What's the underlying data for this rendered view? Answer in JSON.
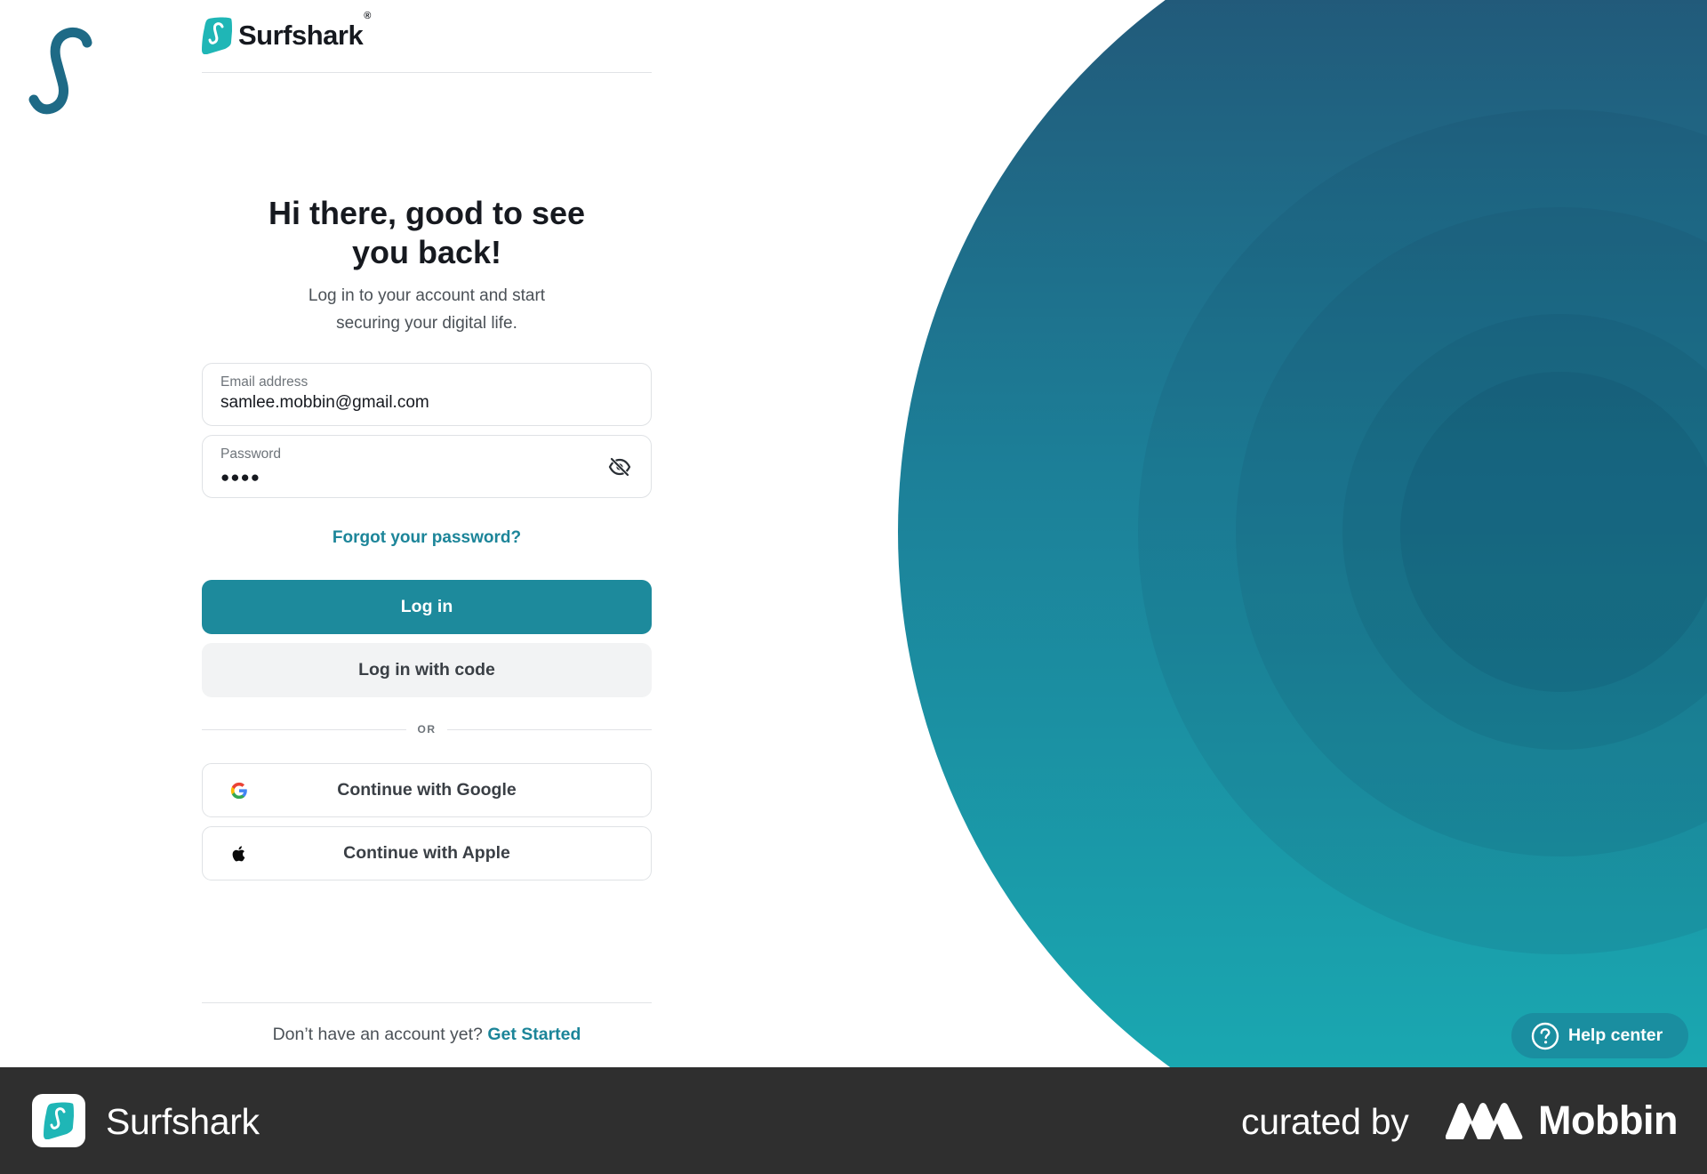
{
  "brand": {
    "name": "Surfshark",
    "registered_mark": "®"
  },
  "login": {
    "headline_line1": "Hi there, good to see",
    "headline_line2": "you back!",
    "subtitle_line1": "Log in to your account and start",
    "subtitle_line2": "securing your digital life.",
    "email": {
      "label": "Email address",
      "value": "samlee.mobbin@gmail.com"
    },
    "password": {
      "label": "Password",
      "value": "●●●●",
      "toggle_icon": "eye-slash-icon"
    },
    "forgot_password": "Forgot your password?",
    "login_button": "Log in",
    "login_with_code_button": "Log in with code",
    "divider_text": "OR",
    "google_button": "Continue with Google",
    "apple_button": "Continue with Apple",
    "signup_prompt": "Don’t have an account yet?",
    "signup_link": "Get Started"
  },
  "help": {
    "label": "Help center",
    "icon": "question-circle-icon"
  },
  "footer": {
    "app_name": "Surfshark",
    "curated_by": "curated by",
    "curator": "Mobbin"
  },
  "colors": {
    "accent": "#1d8a9c",
    "link": "#1c8599",
    "hero_top": "#245072",
    "hero_bottom": "#1ab0b6",
    "footer_bg": "#2f2f2f",
    "logo_teal": "#1fb6b6"
  }
}
